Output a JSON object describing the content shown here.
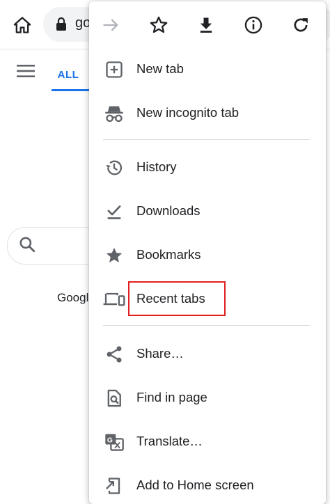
{
  "browser": {
    "url_text": "go",
    "home_icon": "home-icon",
    "lock_icon": "lock-icon"
  },
  "page": {
    "nav": {
      "menu_icon": "hamburger-icon",
      "active_tab_label": "ALL"
    },
    "search": {
      "icon": "search-icon"
    },
    "footer_text": "Googl"
  },
  "menu": {
    "toolbar": [
      {
        "id": "forward",
        "icon": "forward-arrow-icon",
        "enabled": false
      },
      {
        "id": "bookmark",
        "icon": "star-outline-icon",
        "enabled": true
      },
      {
        "id": "download",
        "icon": "download-icon",
        "enabled": true
      },
      {
        "id": "info",
        "icon": "info-icon",
        "enabled": true
      },
      {
        "id": "reload",
        "icon": "reload-icon",
        "enabled": true
      }
    ],
    "items": [
      {
        "label": "New tab",
        "icon": "new-tab-icon"
      },
      {
        "label": "New incognito tab",
        "icon": "incognito-icon"
      },
      {
        "label": "History",
        "icon": "history-icon"
      },
      {
        "label": "Downloads",
        "icon": "downloads-check-icon"
      },
      {
        "label": "Bookmarks",
        "icon": "bookmark-star-icon"
      },
      {
        "label": "Recent tabs",
        "icon": "devices-icon"
      },
      {
        "label": "Share…",
        "icon": "share-icon"
      },
      {
        "label": "Find in page",
        "icon": "find-in-page-icon"
      },
      {
        "label": "Translate…",
        "icon": "translate-icon"
      },
      {
        "label": "Add to Home screen",
        "icon": "add-to-home-screen-icon"
      }
    ],
    "highlighted_item": "Recent tabs"
  },
  "colors": {
    "accent": "#1a73e8",
    "icon_gray": "#5f6368",
    "icon_dark": "#202124",
    "highlight_red": "#e02020"
  }
}
